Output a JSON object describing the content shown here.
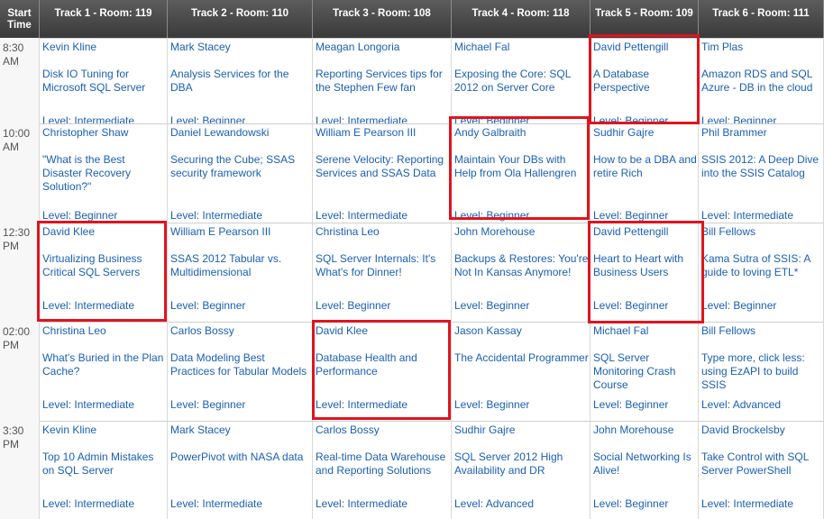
{
  "header": {
    "start_time": "Start Time",
    "tracks": [
      "Track 1 - Room: 119",
      "Track 2 - Room: 110",
      "Track 3 - Room: 108",
      "Track 4 - Room: 118",
      "Track 5 - Room: 109",
      "Track 6 - Room: 111"
    ]
  },
  "slots": [
    {
      "time": "8:30 AM",
      "sessions": [
        {
          "speaker": "Kevin Kline",
          "title": "Disk IO Tuning for Microsoft SQL Server",
          "level": "Level: Intermediate"
        },
        {
          "speaker": "Mark Stacey",
          "title": "Analysis Services for the DBA",
          "level": "Level: Beginner"
        },
        {
          "speaker": "Meagan Longoria",
          "title": "Reporting Services tips for the Stephen Few fan",
          "level": "Level: Intermediate"
        },
        {
          "speaker": "Michael Fal",
          "title": "Exposing the Core: SQL 2012 on Server Core",
          "level": "Level: Beginner"
        },
        {
          "speaker": "David Pettengill",
          "title": "A Database Perspective",
          "level": "Level: Beginner"
        },
        {
          "speaker": "Tim Plas",
          "title": "Amazon RDS and SQL Azure - DB in the cloud",
          "level": "Level: Beginner"
        }
      ]
    },
    {
      "time": "10:00 AM",
      "sessions": [
        {
          "speaker": "Christopher Shaw",
          "title": "\"What is the Best Disaster Recovery Solution?\"",
          "level": "Level: Beginner"
        },
        {
          "speaker": "Daniel Lewandowski",
          "title": "Securing the Cube; SSAS security framework",
          "level": "Level: Intermediate"
        },
        {
          "speaker": "William E Pearson III",
          "title": "Serene Velocity: Reporting Services and SSAS Data",
          "level": "Level: Intermediate"
        },
        {
          "speaker": "Andy Galbraith",
          "title": "Maintain Your DBs with Help from Ola Hallengren",
          "level": "Level: Beginner"
        },
        {
          "speaker": "Sudhir Gajre",
          "title": "How to be a DBA and retire Rich",
          "level": "Level: Beginner"
        },
        {
          "speaker": "Phil Brammer",
          "title": "SSIS 2012: A Deep Dive into the SSIS Catalog",
          "level": "Level: Intermediate"
        }
      ]
    },
    {
      "time": "12:30 PM",
      "sessions": [
        {
          "speaker": "David Klee",
          "title": "Virtualizing Business Critical SQL Servers",
          "level": "Level: Intermediate"
        },
        {
          "speaker": "William E Pearson III",
          "title": "SSAS 2012 Tabular vs. Multidimensional",
          "level": "Level: Beginner"
        },
        {
          "speaker": "Christina Leo",
          "title": "SQL Server Internals: It's What's for Dinner!",
          "level": "Level: Beginner"
        },
        {
          "speaker": "John Morehouse",
          "title": "Backups & Restores: You're Not In Kansas Anymore!",
          "level": "Level: Beginner"
        },
        {
          "speaker": "David Pettengill",
          "title": "Heart to Heart with Business Users",
          "level": "Level: Beginner"
        },
        {
          "speaker": "Bill Fellows",
          "title": "Kama Sutra of SSIS: A guide to loving ETL*",
          "level": "Level: Beginner"
        }
      ]
    },
    {
      "time": "02:00 PM",
      "sessions": [
        {
          "speaker": "Christina Leo",
          "title": "What's Buried in the Plan Cache?",
          "level": "Level: Intermediate"
        },
        {
          "speaker": "Carlos Bossy",
          "title": "Data Modeling Best Practices for Tabular Models",
          "level": "Level: Beginner"
        },
        {
          "speaker": "David Klee",
          "title": "Database Health and Performance",
          "level": "Level: Intermediate"
        },
        {
          "speaker": "Jason Kassay",
          "title": "The Accidental Programmer",
          "level": "Level: Beginner"
        },
        {
          "speaker": "Michael Fal",
          "title": "SQL Server Monitoring Crash Course",
          "level": "Level: Beginner"
        },
        {
          "speaker": "Bill Fellows",
          "title": "Type more, click less: using EzAPI to build SSIS",
          "level": "Level: Advanced"
        }
      ]
    },
    {
      "time": "3:30 PM",
      "sessions": [
        {
          "speaker": "Kevin Kline",
          "title": "Top 10 Admin Mistakes on SQL Server",
          "level": "Level: Intermediate"
        },
        {
          "speaker": "Mark Stacey",
          "title": "PowerPivot with NASA data",
          "level": "Level: Intermediate"
        },
        {
          "speaker": "Carlos Bossy",
          "title": "Real-time Data Warehouse and Reporting Solutions",
          "level": "Level: Intermediate"
        },
        {
          "speaker": "Sudhir Gajre",
          "title": "SQL Server 2012 High Availability and DR",
          "level": "Level: Advanced"
        },
        {
          "speaker": "John Morehouse",
          "title": "Social Networking Is Alive!",
          "level": "Level: Beginner"
        },
        {
          "speaker": "David Brockelsby",
          "title": "Take Control with SQL Server PowerShell",
          "level": "Level: Intermediate"
        }
      ]
    }
  ],
  "highlight_color": "#e0141e",
  "link_color": "#1a5fb4"
}
